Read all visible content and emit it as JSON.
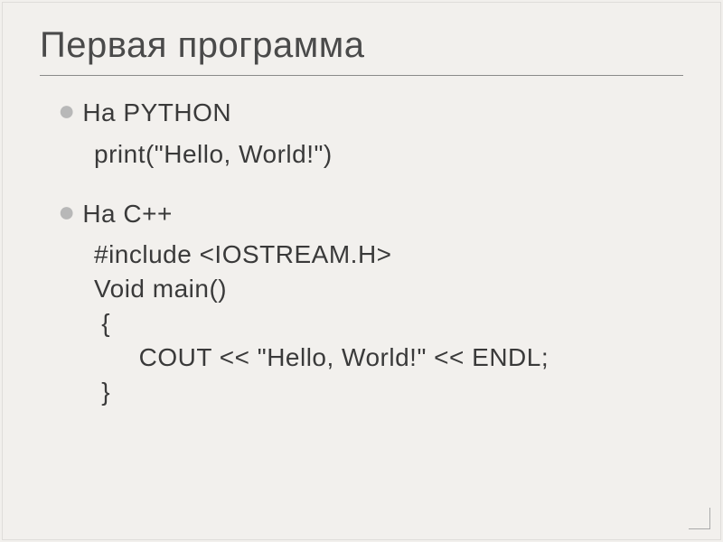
{
  "slide": {
    "title": "Первая программа",
    "bullets": [
      {
        "label": "На PYTHON",
        "code": [
          "print(\"Hello, World!\")"
        ]
      },
      {
        "label": "На С++",
        "code": [
          "#include <IOSTREAM.H>",
          "Void main()",
          " {",
          "      COUT << \"Hello, World!\" << ENDL;",
          "",
          " }"
        ]
      }
    ]
  }
}
